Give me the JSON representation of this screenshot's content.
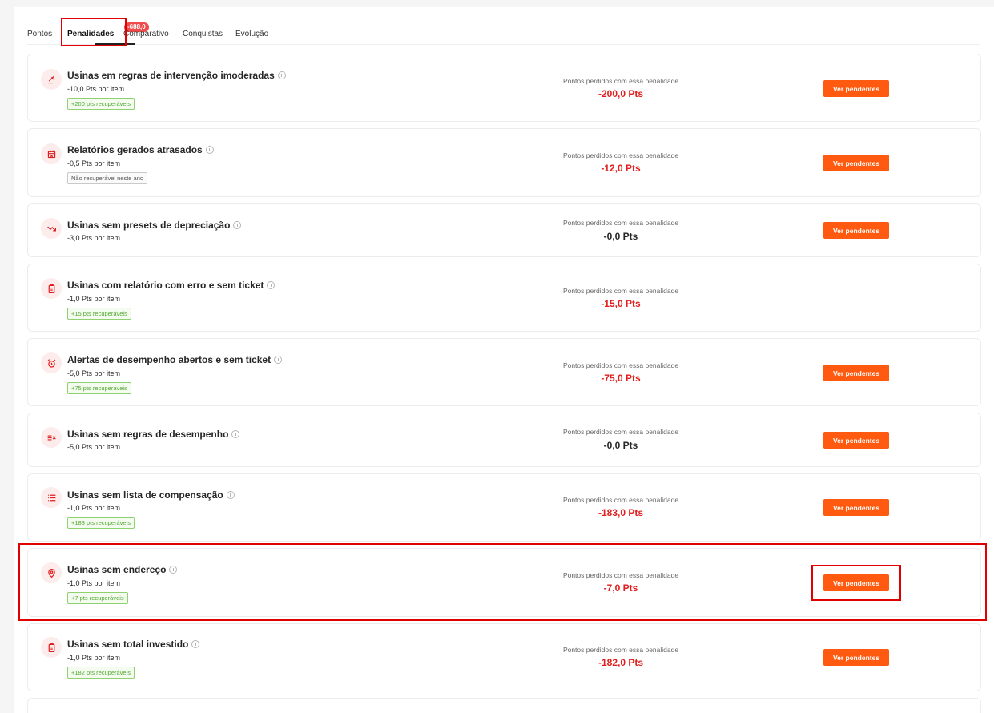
{
  "tabs": [
    {
      "label": "Pontos"
    },
    {
      "label": "Penalidades",
      "badge": "-688,0"
    },
    {
      "label": "Comparativo"
    },
    {
      "label": "Conquistas"
    },
    {
      "label": "Evolução"
    }
  ],
  "lost_label": "Pontos perdidos com essa penalidade",
  "button_label": "Ver pendentes",
  "colors": {
    "accent": "#ff5a0f",
    "loss": "#e11d1d",
    "badge": "#f04a4a",
    "recoverable": "#52a832",
    "highlight": "#e00000"
  },
  "penalties": [
    {
      "icon": "gavel-icon",
      "title": "Usinas em regras de intervenção imoderadas",
      "per_item": "-10,0 Pts por item",
      "tag": "+200 pts recuperáveis",
      "lost": "-200,0 Pts"
    },
    {
      "icon": "calendar-x-icon",
      "title": "Relatórios gerados atrasados",
      "per_item": "-0,5 Pts por item",
      "tag": "Não recuperável neste ano",
      "lost": "-12,0 Pts"
    },
    {
      "icon": "trend-down-icon",
      "title": "Usinas sem presets de depreciação",
      "per_item": "-3,0 Pts por item",
      "tag": "",
      "lost": "-0,0 Pts"
    },
    {
      "icon": "clipboard-icon",
      "title": "Usinas com relatório com erro e sem ticket",
      "per_item": "-1,0 Pts por item",
      "tag": "+15 pts recuperáveis",
      "lost": "-15,0 Pts"
    },
    {
      "icon": "alarm-icon",
      "title": "Alertas de desempenho abertos e sem ticket",
      "per_item": "-5,0 Pts por item",
      "tag": "+75 pts recuperáveis",
      "lost": "-75,0 Pts"
    },
    {
      "icon": "list-x-icon",
      "title": "Usinas sem regras de desempenho",
      "per_item": "-5,0 Pts por item",
      "tag": "",
      "lost": "-0,0 Pts"
    },
    {
      "icon": "list-icon",
      "title": "Usinas sem lista de compensação",
      "per_item": "-1,0 Pts por item",
      "tag": "+183 pts recuperáveis",
      "lost": "-183,0 Pts"
    },
    {
      "icon": "map-pin-icon",
      "title": "Usinas sem endereço",
      "per_item": "-1,0 Pts por item",
      "tag": "+7 pts recuperáveis",
      "lost": "-7,0 Pts"
    },
    {
      "icon": "clipboard-icon",
      "title": "Usinas sem total investido",
      "per_item": "-1,0 Pts por item",
      "tag": "+182 pts recuperáveis",
      "lost": "-182,0 Pts"
    }
  ]
}
